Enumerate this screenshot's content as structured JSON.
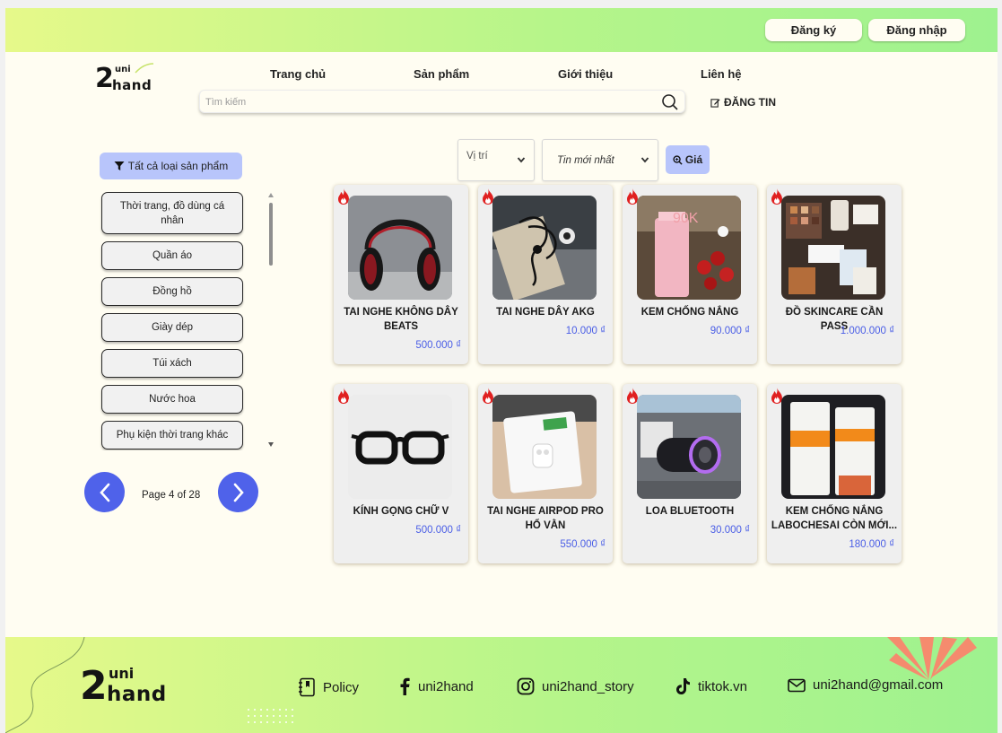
{
  "header": {
    "register_label": "Đăng ký",
    "login_label": "Đăng nhập",
    "logo_small": "uni",
    "logo_big": "2",
    "logo_word": "hand"
  },
  "nav": {
    "items": [
      "Trang chủ",
      "Sản phẩm",
      "Giới thiệu",
      "Liên hệ"
    ]
  },
  "search": {
    "placeholder": "Tìm kiếm",
    "value": ""
  },
  "post_label": "ĐĂNG TIN",
  "sidebar": {
    "all_categories_label": "Tất cả loại sản phẩm",
    "categories": [
      "Thời trang, đồ dùng cá nhân",
      "Quần áo",
      "Đồng hồ",
      "Giày dép",
      "Túi xách",
      "Nước hoa",
      "Phụ kiện thời trang khác"
    ],
    "pagination": {
      "text": "Page 4 of 28",
      "current": 4,
      "total": 28
    }
  },
  "filters": {
    "location_label": "Vị trí",
    "sort_label": "Tin mới nhất",
    "price_label": "Giá"
  },
  "products": [
    {
      "title": "TAI NGHE KHÔNG DÂY BEATS",
      "price": "500.000 ₫",
      "image": "headphones"
    },
    {
      "title": "TAI NGHE DÂY AKG",
      "price": "10.000 ₫",
      "image": "wired-earphones"
    },
    {
      "title": "KEM CHỐNG NẮNG",
      "price": "90.000 ₫",
      "image": "sunscreen-tube",
      "image_text": "90K"
    },
    {
      "title": "ĐỒ SKINCARE CẦN PASS",
      "price": "1.000.000 ₫",
      "image": "skincare-set"
    },
    {
      "title": "KÍNH GỌNG CHỮ V",
      "price": "500.000 ₫",
      "image": "eyeglasses"
    },
    {
      "title": "TAI NGHE AIRPOD PRO HỔ VẰN",
      "price": "550.000 ₫",
      "image": "airpods-box"
    },
    {
      "title": "LOA BLUETOOTH",
      "price": "30.000 ₫",
      "image": "bluetooth-speaker"
    },
    {
      "title": "KEM CHỐNG NẮNG LABOCHESAI CÒN MỚI...",
      "price": "180.000 ₫",
      "image": "laroche-sunscreen"
    }
  ],
  "footer": {
    "links": [
      {
        "label": "Policy",
        "icon": "book-icon"
      },
      {
        "label": "uni2hand",
        "icon": "facebook-icon"
      },
      {
        "label": "uni2hand_story",
        "icon": "instagram-icon"
      },
      {
        "label": "tiktok.vn",
        "icon": "tiktok-icon"
      },
      {
        "label": "uni2hand@gmail.com",
        "icon": "mail-icon"
      }
    ]
  },
  "colors": {
    "accent_blue": "#4f62ea",
    "button_lavender": "#b8c5fb",
    "price_blue": "#4a5ee6",
    "page_bg": "#fffdf2",
    "gradient_start": "#e6f98a",
    "gradient_end": "#9ef28f"
  }
}
